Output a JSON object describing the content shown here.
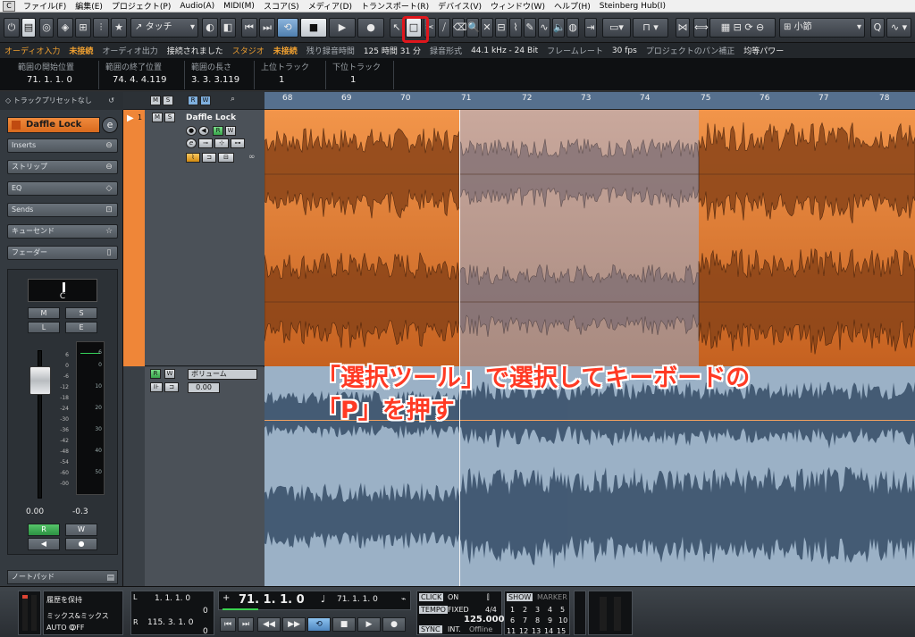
{
  "menu": [
    "ファイル(F)",
    "編集(E)",
    "プロジェクト(P)",
    "Audio(A)",
    "MIDI(M)",
    "スコア(S)",
    "メディア(D)",
    "トランスポート(R)",
    "デバイス(V)",
    "ウィンドウ(W)",
    "ヘルプ(H)",
    "Steinberg Hub(I)"
  ],
  "toolbar": {
    "automation_mode": "タッチ",
    "snap_mode": "小節"
  },
  "status": {
    "audio_in_label": "オーディオ入力",
    "audio_in_value": "未接続",
    "audio_out_label": "オーディオ出力",
    "audio_out_value": "接続されました",
    "studio_label": "スタジオ",
    "studio_value": "未接続",
    "remaining_label": "残り録音時間",
    "remaining_value": "125 時間 31 分",
    "format_label": "録音形式",
    "format_value": "44.1 kHz - 24 Bit",
    "framerate_label": "フレームレート",
    "framerate_value": "30 fps",
    "pan_label": "プロジェクトのパン補正",
    "pan_value": "均等パワー"
  },
  "infoline": {
    "start_label": "範囲の開始位置",
    "start_value": "71. 1. 1.   0",
    "end_label": "範囲の終了位置",
    "end_value": "74. 4. 4.119",
    "length_label": "範囲の長さ",
    "length_value": "3. 3. 3.119",
    "upper_label": "上位トラック",
    "upper_value": "1",
    "lower_label": "下位トラック",
    "lower_value": "1"
  },
  "inspector": {
    "preset": "トラックプリセットなし",
    "track_name": "Daffle Lock",
    "sections": [
      "Inserts",
      "ストリップ",
      "EQ",
      "Sends",
      "キューセンド",
      "フェーダー"
    ],
    "pan": "C",
    "m": "M",
    "s": "S",
    "l": "L",
    "e": "E",
    "scale": [
      "6",
      "0",
      "-6",
      "-12",
      "-18",
      "-24",
      "-30",
      "-36",
      "-42",
      "-48",
      "-54",
      "-60",
      "-00"
    ],
    "meter_scale": [
      "6",
      "0",
      "10",
      "20",
      "30",
      "40",
      "50"
    ],
    "fader_value": "0.00",
    "meter_value": "-0.3",
    "r": "R",
    "w": "W",
    "notepad": "ノートパッド"
  },
  "tracks": {
    "track1": {
      "number": "1",
      "name": "Daffle Lock",
      "m": "M",
      "s": "S",
      "r": "R",
      "w": "W"
    },
    "track2": {
      "r": "R",
      "w": "W",
      "param": "ボリューム",
      "value": "0.00"
    }
  },
  "tracklist_header": {
    "m": "M",
    "s": "S",
    "r": "R",
    "w": "W"
  },
  "ruler": [
    "68",
    "69",
    "70",
    "71",
    "72",
    "73",
    "74",
    "75",
    "76",
    "77",
    "78"
  ],
  "annotation": {
    "line1": "「選択ツール」で選択してキーボードの",
    "line2": "「P」を押す"
  },
  "transport": {
    "history_label": "履歴を保持",
    "mix_label": "ミックス&ミックス",
    "auto_q": "AUTO Q",
    "auto_q_value": "OFF",
    "left_locator": "1. 1. 1.   0",
    "left_locator2": "0",
    "right_locator": "115. 3. 1.   0",
    "right_locator2": "0",
    "primary_time": "71. 1. 1.   0",
    "secondary_time": "71. 1. 1.   0",
    "click_label": "CLICK",
    "click_value": "ON",
    "tempo_label": "TEMPO",
    "tempo_mode": "FIXED",
    "signature": "4/4",
    "tempo_value": "125.000",
    "sync_label": "SYNC",
    "sync_mode": "INT.",
    "sync_value": "Offline",
    "show_label": "SHOW",
    "marker_label": "MARKER",
    "marker_numbers": [
      "1",
      "2",
      "3",
      "4",
      "5",
      "6",
      "7",
      "8",
      "9",
      "10",
      "11",
      "12",
      "13",
      "14",
      "15"
    ]
  },
  "colors": {
    "track_orange": "#ef8638",
    "selection_range": "#b79c94",
    "annotation_red": "#ff3a24",
    "highlight_red": "#e0161c"
  }
}
